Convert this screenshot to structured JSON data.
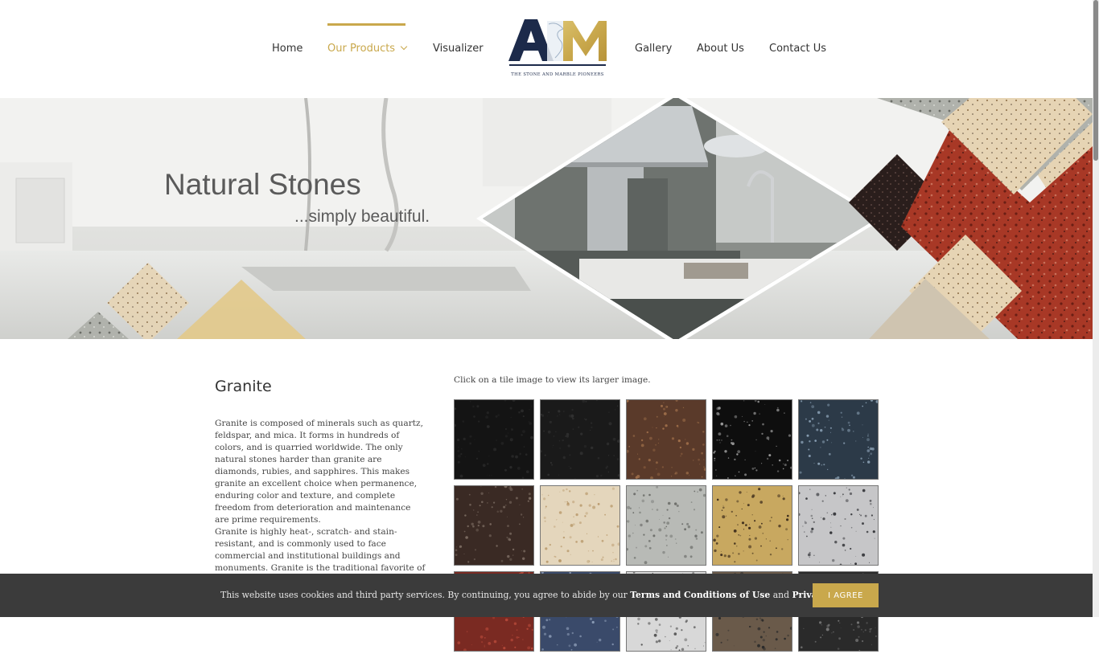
{
  "nav": {
    "home": "Home",
    "products": "Our Products",
    "visualizer": "Visualizer",
    "gallery": "Gallery",
    "about": "About Us",
    "contact": "Contact Us"
  },
  "logo": {
    "letters": "ABM",
    "tagline": "THE STONE AND MARBLE PIONEERS"
  },
  "hero": {
    "title": "Natural Stones",
    "subtitle": "...simply beautiful."
  },
  "content": {
    "title": "Granite",
    "para1": "Granite is composed of minerals such as quartz, feldspar, and mica. It forms in hundreds of colors, and is quarried worldwide. The only natural stones harder than granite are diamonds, rubies, and sapphires. This makes granite an excellent choice when permanence, enduring color and texture, and complete freedom from deterioration and maintenance are prime requirements.",
    "para2": "Granite is highly heat-, scratch- and stain-resistant, and is commonly used to face commercial and institutional buildings and monuments. Granite is the traditional favorite of countertop materials for",
    "tile_hint": "Click on a tile image to view its larger image."
  },
  "tiles": [
    {
      "color": "#141414",
      "speck": "#2a2a2a"
    },
    {
      "color": "#1a1a1a",
      "speck": "#303030"
    },
    {
      "color": "#5a3a2a",
      "speck": "#a0704a"
    },
    {
      "color": "#0e0e0e",
      "speck": "#9a9a9a"
    },
    {
      "color": "#2c3a48",
      "speck": "#8aa0b4"
    },
    {
      "color": "#3a2a24",
      "speck": "#7a6a60"
    },
    {
      "color": "#e4d6bc",
      "speck": "#b8986a"
    },
    {
      "color": "#b8bab6",
      "speck": "#6a6c68"
    },
    {
      "color": "#c8a860",
      "speck": "#3a2a1a"
    },
    {
      "color": "#c6c6c8",
      "speck": "#333438"
    },
    {
      "color": "#7a2a22",
      "speck": "#b84a3a"
    },
    {
      "color": "#3a4a6a",
      "speck": "#8a9ab4"
    },
    {
      "color": "#d8d8d8",
      "speck": "#555555"
    },
    {
      "color": "#6a5a4a",
      "speck": "#2a2a2a"
    },
    {
      "color": "#2a2a2a",
      "speck": "#777777"
    }
  ],
  "cookie": {
    "text_before": "This website uses cookies and third party services. By continuing, you agree to abide by our ",
    "terms": "Terms and Conditions of Use",
    "and": " and ",
    "privacy": "Privacy Policy",
    "end": ".",
    "button": "I AGREE"
  },
  "colors": {
    "accent": "#c9a84c",
    "navy": "#1c2a4a",
    "cookie_bg": "#3b3b3b"
  }
}
